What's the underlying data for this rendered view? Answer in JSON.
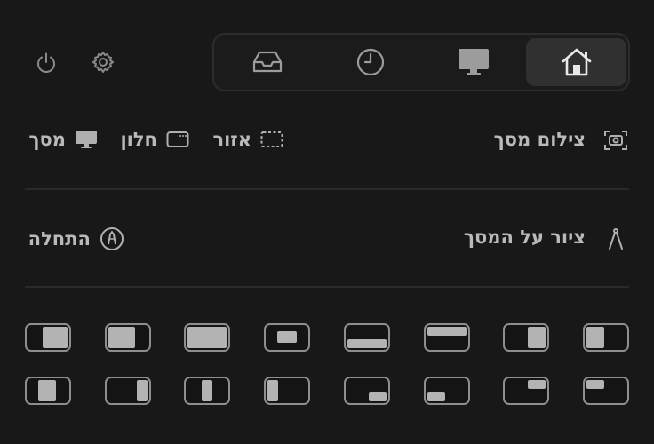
{
  "toolbar": {
    "power_icon": "power-icon",
    "settings_icon": "gear-icon"
  },
  "tabs": [
    {
      "name": "inbox",
      "icon": "tray-icon",
      "active": false
    },
    {
      "name": "history",
      "icon": "clock-icon",
      "active": false
    },
    {
      "name": "display",
      "icon": "monitor-icon",
      "active": false
    },
    {
      "name": "home",
      "icon": "home-icon",
      "active": true
    }
  ],
  "screenshot": {
    "title": "צילום מסך",
    "options": {
      "area": "אזור",
      "window": "חלון",
      "screen": "מסך"
    }
  },
  "draw": {
    "title": "ציור על המסך",
    "start": "התחלה"
  },
  "layouts": {
    "row1": [
      "center-large",
      "left-square",
      "maximize",
      "center-small",
      "bottom-half",
      "top-half",
      "right-narrow",
      "left-narrow"
    ],
    "row2": [
      "left-third-center",
      "right-third",
      "center-third",
      "left-third",
      "bottom-right-quarter",
      "bottom-left-quarter",
      "top-right-quarter",
      "top-left-quarter"
    ]
  },
  "colors": {
    "background": "#181818",
    "text": "#b9b9b9",
    "accent_tab": "#303030"
  }
}
